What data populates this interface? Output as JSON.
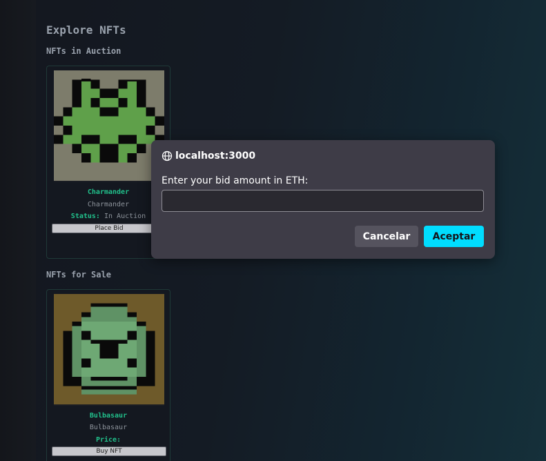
{
  "page": {
    "title": "Explore NFTs"
  },
  "auction": {
    "heading": "NFTs in Auction",
    "card": {
      "name": "Charmander",
      "description": "Charmander",
      "status_label": "Status:",
      "status_value": "In Auction",
      "button_label": "Place Bid",
      "art_icon": "pixel-frog-icon",
      "art_colors": {
        "background": "#7d7c6b",
        "body": "#5fa04a",
        "outline": "#0a0a0a"
      }
    }
  },
  "sale": {
    "heading": "NFTs for Sale",
    "card": {
      "name": "Bulbasaur",
      "description": "Bulbasaur",
      "price_label": "Price:",
      "button_label": "Buy NFT",
      "art_icon": "pixel-ghost-icon",
      "art_colors": {
        "background": "#6e5a2a",
        "body": "#5f9265",
        "outline": "#0a0a0a"
      }
    }
  },
  "dialog": {
    "origin": "localhost:3000",
    "origin_icon": "globe-icon",
    "message": "Enter your bid amount in ETH:",
    "input_value": "",
    "cancel_label": "Cancelar",
    "accept_label": "Aceptar",
    "accent_color": "#00ddff"
  }
}
